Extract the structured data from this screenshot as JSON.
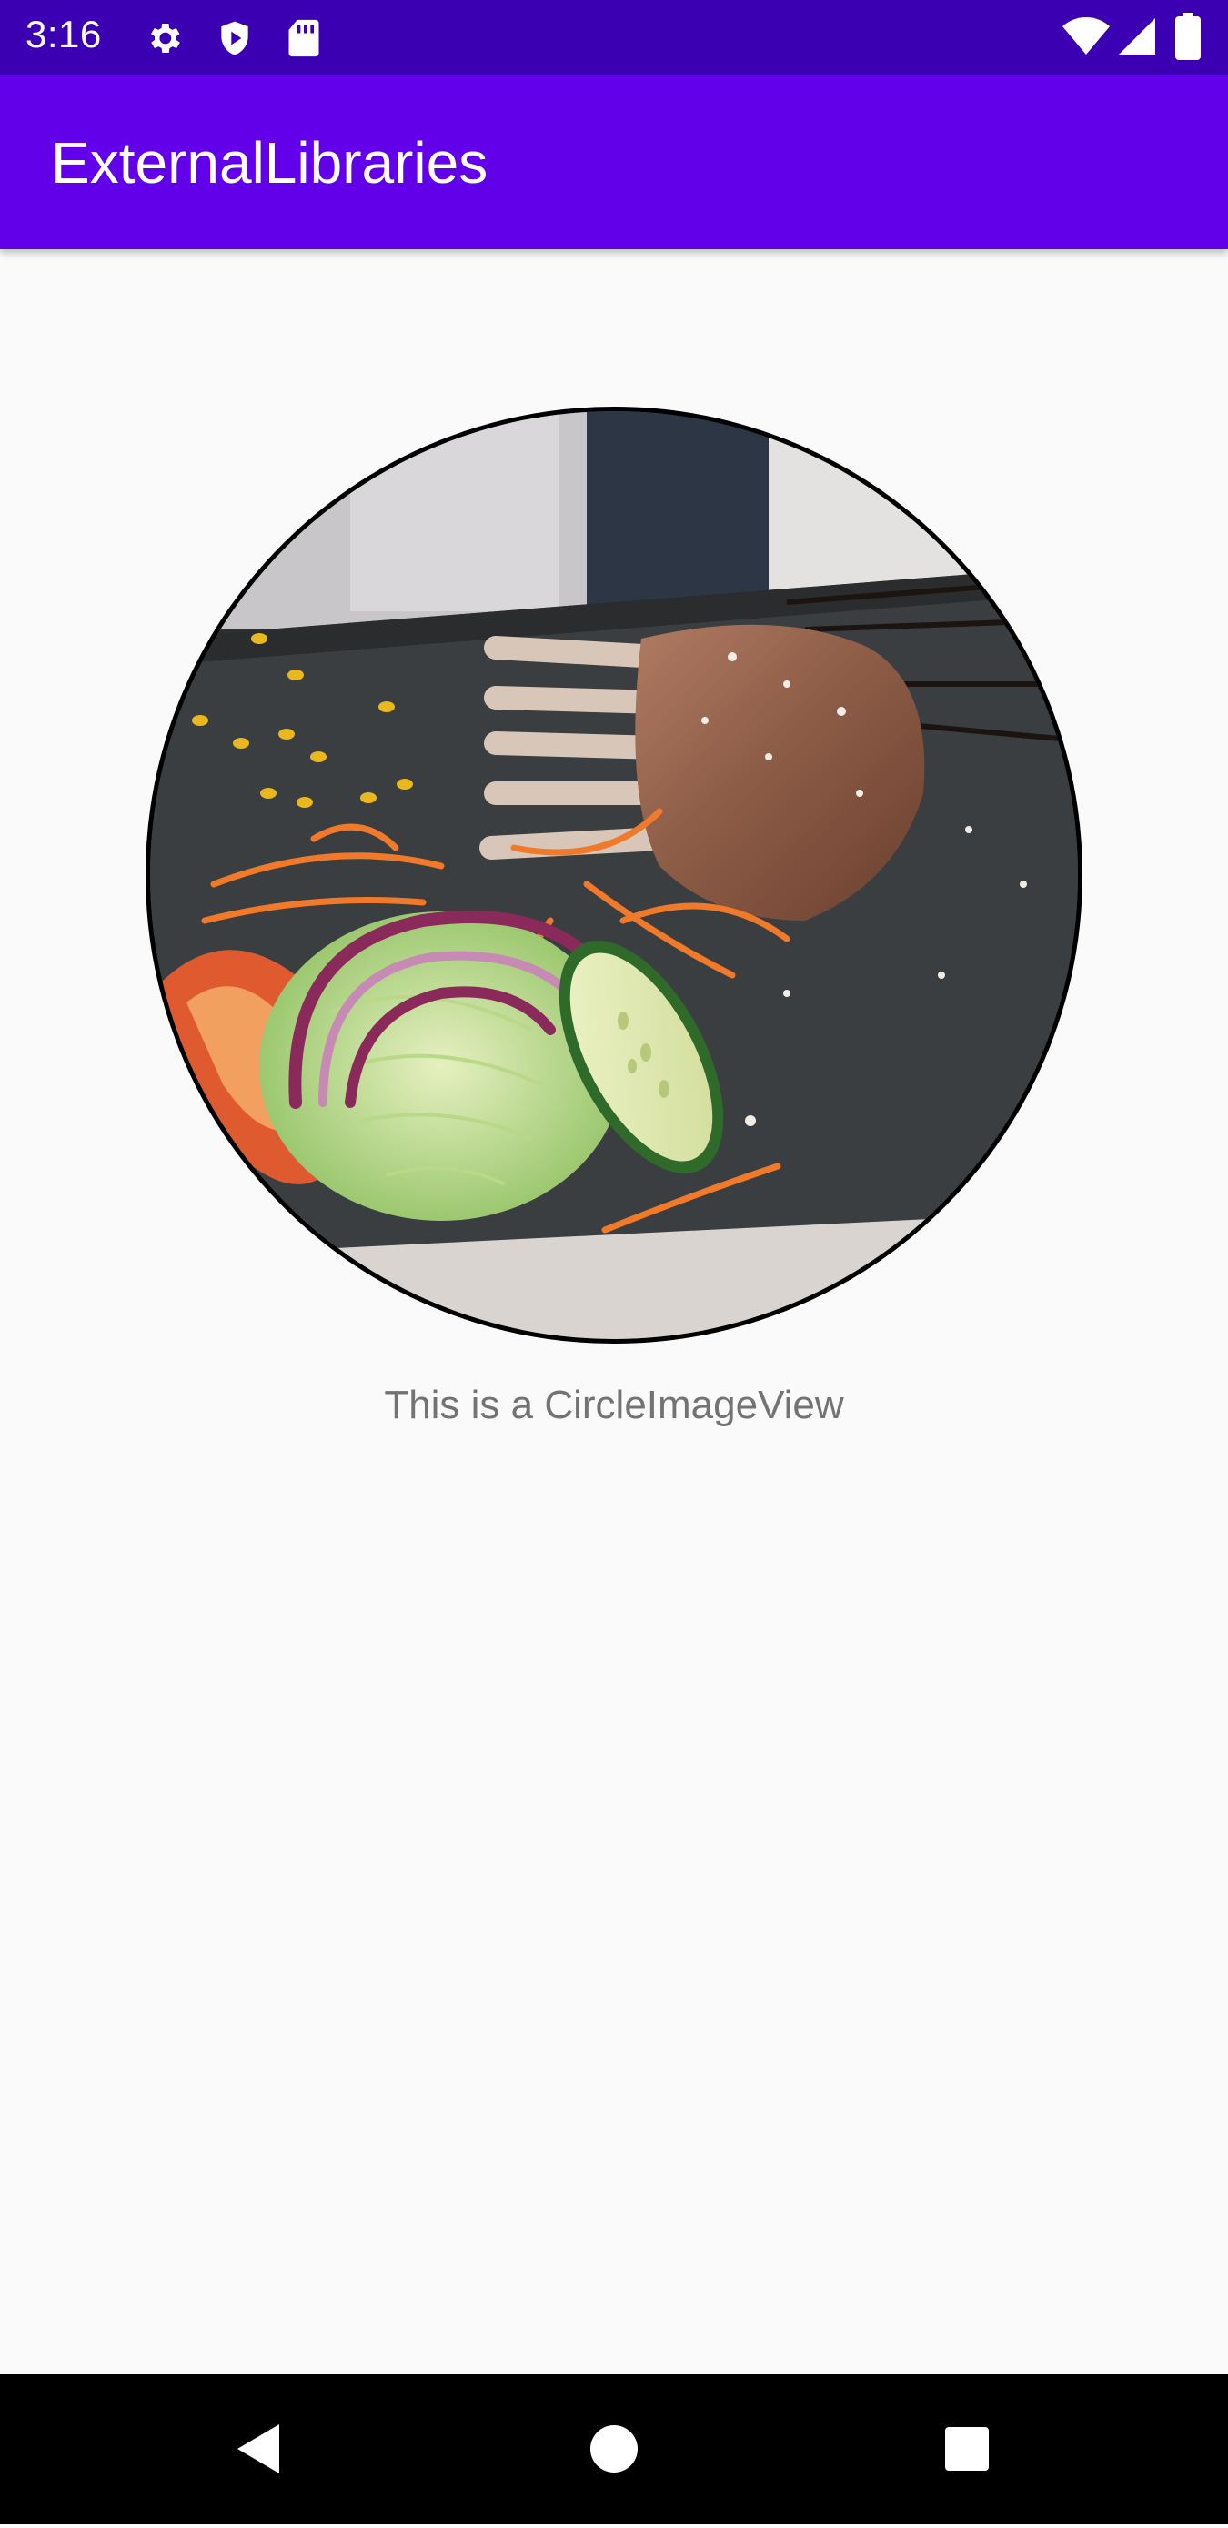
{
  "status_bar": {
    "time": "3:16",
    "icons": [
      "settings-icon",
      "shield-play-icon",
      "sd-card-icon",
      "wifi-icon",
      "signal-icon",
      "battery-icon"
    ]
  },
  "app_bar": {
    "title": "ExternalLibraries",
    "color": "#6200ea"
  },
  "main": {
    "image_caption": "This is a CircleImageView"
  },
  "nav_bar": {
    "buttons": [
      "back-icon",
      "home-icon",
      "recents-icon"
    ]
  }
}
